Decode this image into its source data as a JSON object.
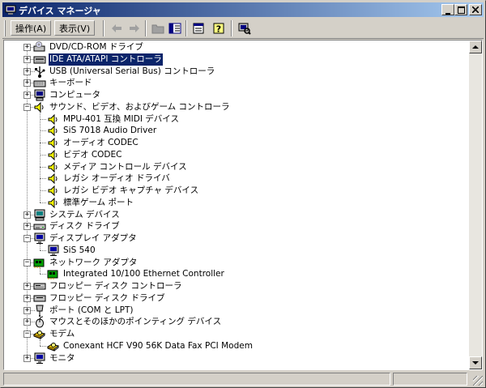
{
  "window": {
    "title": "デバイス マネージャ",
    "title_icon": "device-manager-icon",
    "controls": [
      "minimize",
      "maximize",
      "close"
    ]
  },
  "toolbar": {
    "action_label": "操作(A)",
    "view_label": "表示(V)",
    "tools": [
      "back-arrow-icon",
      "forward-arrow-icon",
      "up-folder-icon",
      "show-tree-icon",
      "properties-icon",
      "help-icon",
      "scan-hardware-icon"
    ]
  },
  "tree": [
    {
      "label": "DVD/CD-ROM ドライブ",
      "icon": "cdrom-drive-icon",
      "expanded": false
    },
    {
      "label": "IDE ATA/ATAPI コントローラ",
      "icon": "ide-controller-icon",
      "expanded": false,
      "selected": true
    },
    {
      "label": "USB (Universal Serial Bus) コントローラ",
      "icon": "usb-icon",
      "expanded": false
    },
    {
      "label": "キーボード",
      "icon": "keyboard-icon",
      "expanded": false
    },
    {
      "label": "コンピュータ",
      "icon": "computer-icon",
      "expanded": false
    },
    {
      "label": "サウンド、ビデオ、およびゲーム コントローラ",
      "icon": "sound-icon",
      "expanded": true,
      "children": [
        {
          "label": "MPU-401 互換 MIDI デバイス",
          "icon": "sound-device-icon"
        },
        {
          "label": "SiS 7018 Audio Driver",
          "icon": "sound-device-icon"
        },
        {
          "label": "オーディオ CODEC",
          "icon": "sound-device-icon"
        },
        {
          "label": "ビデオ CODEC",
          "icon": "sound-device-icon"
        },
        {
          "label": "メディア コントロール デバイス",
          "icon": "sound-device-icon"
        },
        {
          "label": "レガシ オーディオ ドライバ",
          "icon": "sound-device-icon"
        },
        {
          "label": "レガシ ビデオ キャプチャ デバイス",
          "icon": "sound-device-icon"
        },
        {
          "label": "標準ゲーム ポート",
          "icon": "sound-device-icon"
        }
      ]
    },
    {
      "label": "システム デバイス",
      "icon": "system-device-icon",
      "expanded": false
    },
    {
      "label": "ディスク ドライブ",
      "icon": "disk-drive-icon",
      "expanded": false
    },
    {
      "label": "ディスプレイ アダプタ",
      "icon": "display-adapter-icon",
      "expanded": true,
      "children": [
        {
          "label": "SiS 540",
          "icon": "display-adapter-icon"
        }
      ]
    },
    {
      "label": "ネットワーク アダプタ",
      "icon": "network-adapter-icon",
      "expanded": true,
      "children": [
        {
          "label": "Integrated 10/100 Ethernet Controller",
          "icon": "network-adapter-icon"
        }
      ]
    },
    {
      "label": "フロッピー ディスク コントローラ",
      "icon": "floppy-controller-icon",
      "expanded": false
    },
    {
      "label": "フロッピー ディスク ドライブ",
      "icon": "floppy-drive-icon",
      "expanded": false
    },
    {
      "label": "ポート (COM と LPT)",
      "icon": "port-icon",
      "expanded": false
    },
    {
      "label": "マウスとそのほかのポインティング デバイス",
      "icon": "mouse-icon",
      "expanded": false
    },
    {
      "label": "モデム",
      "icon": "modem-icon",
      "expanded": true,
      "children": [
        {
          "label": "Conexant HCF V90 56K Data Fax PCI Modem",
          "icon": "modem-icon"
        }
      ]
    },
    {
      "label": "モニタ",
      "icon": "monitor-icon",
      "expanded": false
    }
  ],
  "colors": {
    "face": "#d4d0c8",
    "title_start": "#0a246a",
    "title_end": "#a6caf0",
    "selection": "#0a246a",
    "tree_bg": "#ffffff"
  }
}
